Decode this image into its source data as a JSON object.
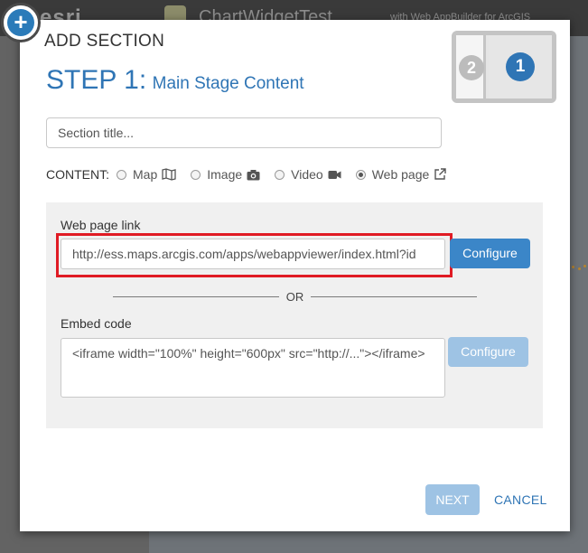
{
  "background": {
    "logo_text": "esri",
    "app_title": "ChartWidgetTest",
    "app_subtitle": "with Web AppBuilder for ArcGIS"
  },
  "modal": {
    "title": "ADD SECTION",
    "step_number": "STEP 1:",
    "step_subtitle": "Main Stage Content",
    "layout_thumbnail": {
      "secondary_number": "2",
      "primary_number": "1"
    },
    "section_title_placeholder": "Section title...",
    "content": {
      "label": "CONTENT:",
      "options": [
        {
          "label": "Map",
          "icon": "map-icon",
          "checked": false
        },
        {
          "label": "Image",
          "icon": "camera-icon",
          "checked": false
        },
        {
          "label": "Video",
          "icon": "video-camera-icon",
          "checked": false
        },
        {
          "label": "Web page",
          "icon": "external-link-icon",
          "checked": true
        }
      ]
    },
    "web_page": {
      "link_label": "Web page link",
      "link_value": "http://ess.maps.arcgis.com/apps/webappviewer/index.html?id",
      "configure_label": "Configure",
      "or_text": "OR",
      "embed_label": "Embed code",
      "embed_placeholder": "<iframe width=\"100%\" height=\"600px\" src=\"http://...\"></iframe>",
      "embed_configure_label": "Configure"
    },
    "footer": {
      "next_label": "NEXT",
      "cancel_label": "CANCEL"
    }
  },
  "colors": {
    "accent": "#2f75b5",
    "button_primary": "#3b86c8",
    "button_disabled": "#9ec3e4",
    "highlight_border": "#e01b24"
  }
}
